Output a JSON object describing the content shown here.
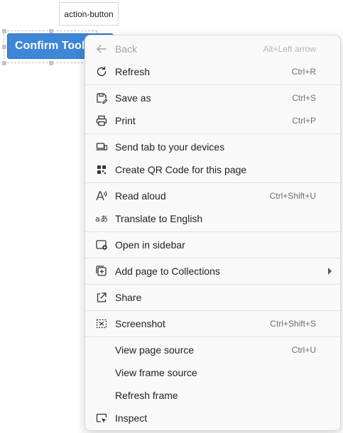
{
  "tag_label": "action-button",
  "button_label": "Confirm Tools",
  "menu": {
    "back": {
      "label": "Back",
      "shortcut": "Alt+Left arrow"
    },
    "refresh": {
      "label": "Refresh",
      "shortcut": "Ctrl+R"
    },
    "save_as": {
      "label": "Save as",
      "shortcut": "Ctrl+S"
    },
    "print": {
      "label": "Print",
      "shortcut": "Ctrl+P"
    },
    "send_tab": {
      "label": "Send tab to your devices"
    },
    "qr_code": {
      "label": "Create QR Code for this page"
    },
    "read_aloud": {
      "label": "Read aloud",
      "shortcut": "Ctrl+Shift+U"
    },
    "translate": {
      "label": "Translate to English"
    },
    "open_sidebar": {
      "label": "Open in sidebar"
    },
    "collections": {
      "label": "Add page to Collections"
    },
    "share": {
      "label": "Share"
    },
    "screenshot": {
      "label": "Screenshot",
      "shortcut": "Ctrl+Shift+S"
    },
    "view_source": {
      "label": "View page source",
      "shortcut": "Ctrl+U"
    },
    "view_frame_source": {
      "label": "View frame source"
    },
    "refresh_frame": {
      "label": "Refresh frame"
    },
    "inspect": {
      "label": "Inspect"
    }
  },
  "colors": {
    "button": "#3d86d8",
    "menu_bg": "#f9f9f9",
    "disabled_text": "#a3a3a3"
  }
}
